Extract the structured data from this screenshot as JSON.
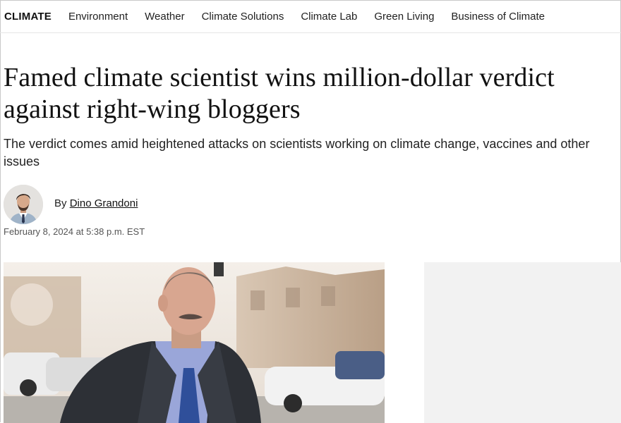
{
  "nav": {
    "brand": "CLIMATE",
    "items": [
      "Environment",
      "Weather",
      "Climate Solutions",
      "Climate Lab",
      "Green Living",
      "Business of Climate"
    ]
  },
  "article": {
    "headline": "Famed climate scientist wins million-dollar verdict against right-wing bloggers",
    "dek": "The verdict comes amid heightened attacks on scientists working on climate change, vaccines and other issues",
    "byline_prefix": "By",
    "author": "Dino Grandoni",
    "timestamp": "February 8, 2024 at 5:38 p.m. EST"
  },
  "colors": {
    "text": "#111111",
    "muted": "#555555",
    "ad_background": "#f2f2f2"
  },
  "icons": {
    "avatar": "author-avatar-photo",
    "hero": "hero-photo"
  }
}
